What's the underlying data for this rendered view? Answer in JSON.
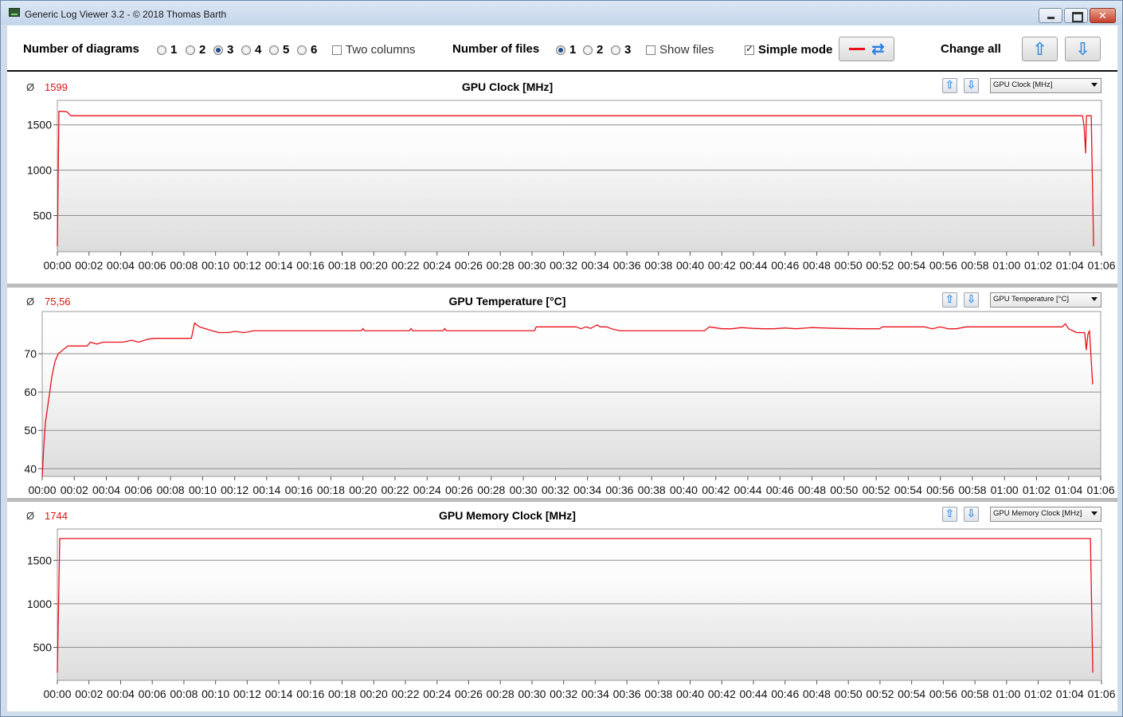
{
  "window": {
    "title": "Generic Log Viewer 3.2 - © 2018 Thomas Barth",
    "icon": "log-viewer-app-icon"
  },
  "toolbar": {
    "diagrams_label": "Number of diagrams",
    "diagram_options": [
      "1",
      "2",
      "3",
      "4",
      "5",
      "6"
    ],
    "diagrams_selected": "3",
    "two_columns_label": "Two columns",
    "two_columns_checked": false,
    "files_label": "Number of files",
    "file_options": [
      "1",
      "2",
      "3"
    ],
    "files_selected": "1",
    "show_files_label": "Show files",
    "show_files_checked": false,
    "simple_mode_label": "Simple mode",
    "simple_mode_checked": true,
    "change_all_label": "Change all",
    "accent_color": "#3a8be0",
    "series_color": "#e8111b"
  },
  "chart_data": [
    {
      "type": "line",
      "title": "GPU Clock [MHz]",
      "avg_symbol": "Ø",
      "avg_value": "1599",
      "selector": "GPU Clock [MHz]",
      "x_ticks": [
        "00:00",
        "00:02",
        "00:04",
        "00:06",
        "00:08",
        "00:10",
        "00:12",
        "00:14",
        "00:16",
        "00:18",
        "00:20",
        "00:22",
        "00:24",
        "00:26",
        "00:28",
        "00:30",
        "00:32",
        "00:34",
        "00:36",
        "00:38",
        "00:40",
        "00:42",
        "00:44",
        "00:46",
        "00:48",
        "00:50",
        "00:52",
        "00:54",
        "00:56",
        "00:58",
        "01:00",
        "01:02",
        "01:04",
        "01:06"
      ],
      "y_ticks": [
        500,
        1000,
        1500
      ],
      "xlim": [
        0,
        66
      ],
      "ylim": [
        100,
        1770
      ],
      "grid": true,
      "series": [
        {
          "x": [
            0,
            0.1,
            0.25,
            0.6,
            0.85,
            1.0,
            10,
            20,
            30,
            40,
            50,
            60,
            64.8,
            64.9,
            65.0,
            65.05,
            65.15,
            65.35,
            65.5
          ],
          "y": [
            160,
            1650,
            1650,
            1645,
            1600,
            1600,
            1600,
            1600,
            1600,
            1600,
            1600,
            1600,
            1600,
            1480,
            1190,
            1600,
            1600,
            1600,
            160
          ]
        }
      ]
    },
    {
      "type": "line",
      "title": "GPU Temperature [°C]",
      "avg_symbol": "Ø",
      "avg_value": "75,56",
      "selector": "GPU Temperature [°C]",
      "x_ticks": [
        "00:00",
        "00:02",
        "00:04",
        "00:06",
        "00:08",
        "00:10",
        "00:12",
        "00:14",
        "00:16",
        "00:18",
        "00:20",
        "00:22",
        "00:24",
        "00:26",
        "00:28",
        "00:30",
        "00:32",
        "00:34",
        "00:36",
        "00:38",
        "00:40",
        "00:42",
        "00:44",
        "00:46",
        "00:48",
        "00:50",
        "00:52",
        "00:54",
        "00:56",
        "00:58",
        "01:00",
        "01:02",
        "01:04",
        "01:06"
      ],
      "y_ticks": [
        40,
        70,
        60,
        50
      ],
      "xlim": [
        0,
        66
      ],
      "ylim": [
        38,
        81
      ],
      "grid": true,
      "series": [
        {
          "x": [
            0,
            0.1,
            0.2,
            0.4,
            0.6,
            0.8,
            1.0,
            1.3,
            1.6,
            2.0,
            2.8,
            3.0,
            3.4,
            3.8,
            4.2,
            4.6,
            5.0,
            5.6,
            6.0,
            6.6,
            7.0,
            7.8,
            8.6,
            9.3,
            9.5,
            9.8,
            10.2,
            10.6,
            11.0,
            11.6,
            12.0,
            12.6,
            13.2,
            14.0,
            16.0,
            18.0,
            19.9,
            20.0,
            20.1,
            22.0,
            22.9,
            23.0,
            23.1,
            25.0,
            25.1,
            25.2,
            27.0,
            30.7,
            30.8,
            33.3,
            33.6,
            33.9,
            34.2,
            34.6,
            34.8,
            35.2,
            35.5,
            36.0,
            41.3,
            41.6,
            42.4,
            43.0,
            43.6,
            44.3,
            45.0,
            45.6,
            46.3,
            47.0,
            48.0,
            49.5,
            51.0,
            52.2,
            52.4,
            55.0,
            55.5,
            56.0,
            56.5,
            57.0,
            57.6,
            58.0,
            63.6,
            63.8,
            64.0,
            64.5,
            65.0,
            65.1,
            65.2,
            65.3,
            65.5
          ],
          "y": [
            38,
            46,
            52,
            58,
            64,
            68,
            70,
            71,
            72,
            72,
            72,
            73,
            72.5,
            73,
            73,
            73,
            73,
            73.5,
            73,
            73.8,
            74,
            74,
            74,
            74,
            78,
            77,
            76.5,
            76,
            75.5,
            75.5,
            75.8,
            75.5,
            76,
            76,
            76,
            76,
            76,
            76.6,
            76,
            76,
            76,
            76.6,
            76,
            76,
            76.6,
            76,
            76,
            76,
            77,
            77,
            76.5,
            77,
            76.6,
            77.5,
            77,
            77,
            76.5,
            76,
            76,
            77,
            76.5,
            76.5,
            76.8,
            76.6,
            76.5,
            76.5,
            76.7,
            76.5,
            76.8,
            76.6,
            76.5,
            76.5,
            77,
            77,
            76.5,
            77,
            76.5,
            76.5,
            77,
            77,
            77,
            77.8,
            76.5,
            75.5,
            75.5,
            71,
            75,
            76,
            62
          ]
        }
      ]
    },
    {
      "type": "line",
      "title": "GPU Memory Clock [MHz]",
      "avg_symbol": "Ø",
      "avg_value": "1744",
      "selector": "GPU Memory Clock [MHz]",
      "x_ticks": [
        "00:00",
        "00:02",
        "00:04",
        "00:06",
        "00:08",
        "00:10",
        "00:12",
        "00:14",
        "00:16",
        "00:18",
        "00:20",
        "00:22",
        "00:24",
        "00:26",
        "00:28",
        "00:30",
        "00:32",
        "00:34",
        "00:36",
        "00:38",
        "00:40",
        "00:42",
        "00:44",
        "00:46",
        "00:48",
        "00:50",
        "00:52",
        "00:54",
        "00:56",
        "00:58",
        "01:00",
        "01:02",
        "01:04",
        "01:06"
      ],
      "y_ticks": [
        500,
        1000,
        1500
      ],
      "xlim": [
        0,
        66
      ],
      "ylim": [
        120,
        1860
      ],
      "grid": true,
      "series": [
        {
          "x": [
            0,
            0.15,
            65.3,
            65.45
          ],
          "y": [
            210,
            1750,
            1750,
            210
          ]
        }
      ]
    }
  ]
}
